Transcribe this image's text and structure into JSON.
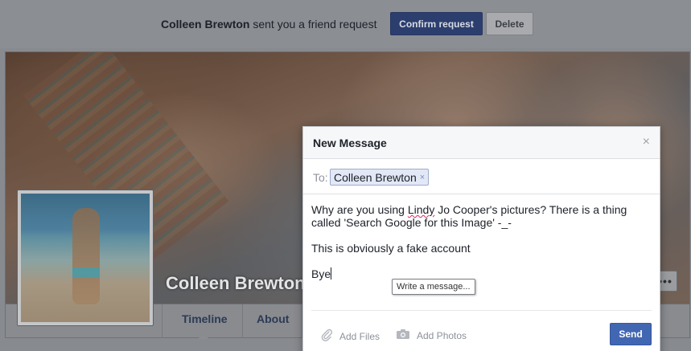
{
  "friend_request": {
    "name": "Colleen Brewton",
    "text": "sent you a friend request",
    "confirm_label": "Confirm request",
    "delete_label": "Delete"
  },
  "profile": {
    "name": "Colleen Brewton",
    "more_label": "•••",
    "tabs": [
      "Timeline",
      "About"
    ]
  },
  "message_dialog": {
    "title": "New Message",
    "close_label": "×",
    "to_label": "To:",
    "recipient": "Colleen Brewton",
    "recipient_remove": "×",
    "body": {
      "line1_before": "Why are you using ",
      "line1_misspelled": "Lindy",
      "line1_after": " Jo Cooper's pictures? There is a thing called 'Search Google for this Image' -_-",
      "line2": "This is obviously a fake account",
      "line3": "Bye"
    },
    "placeholder_tooltip": "Write a message...",
    "add_files_label": "Add Files",
    "add_photos_label": "Add Photos",
    "send_label": "Send"
  },
  "icons": [
    "paperclip-icon",
    "camera-icon",
    "close-icon"
  ]
}
